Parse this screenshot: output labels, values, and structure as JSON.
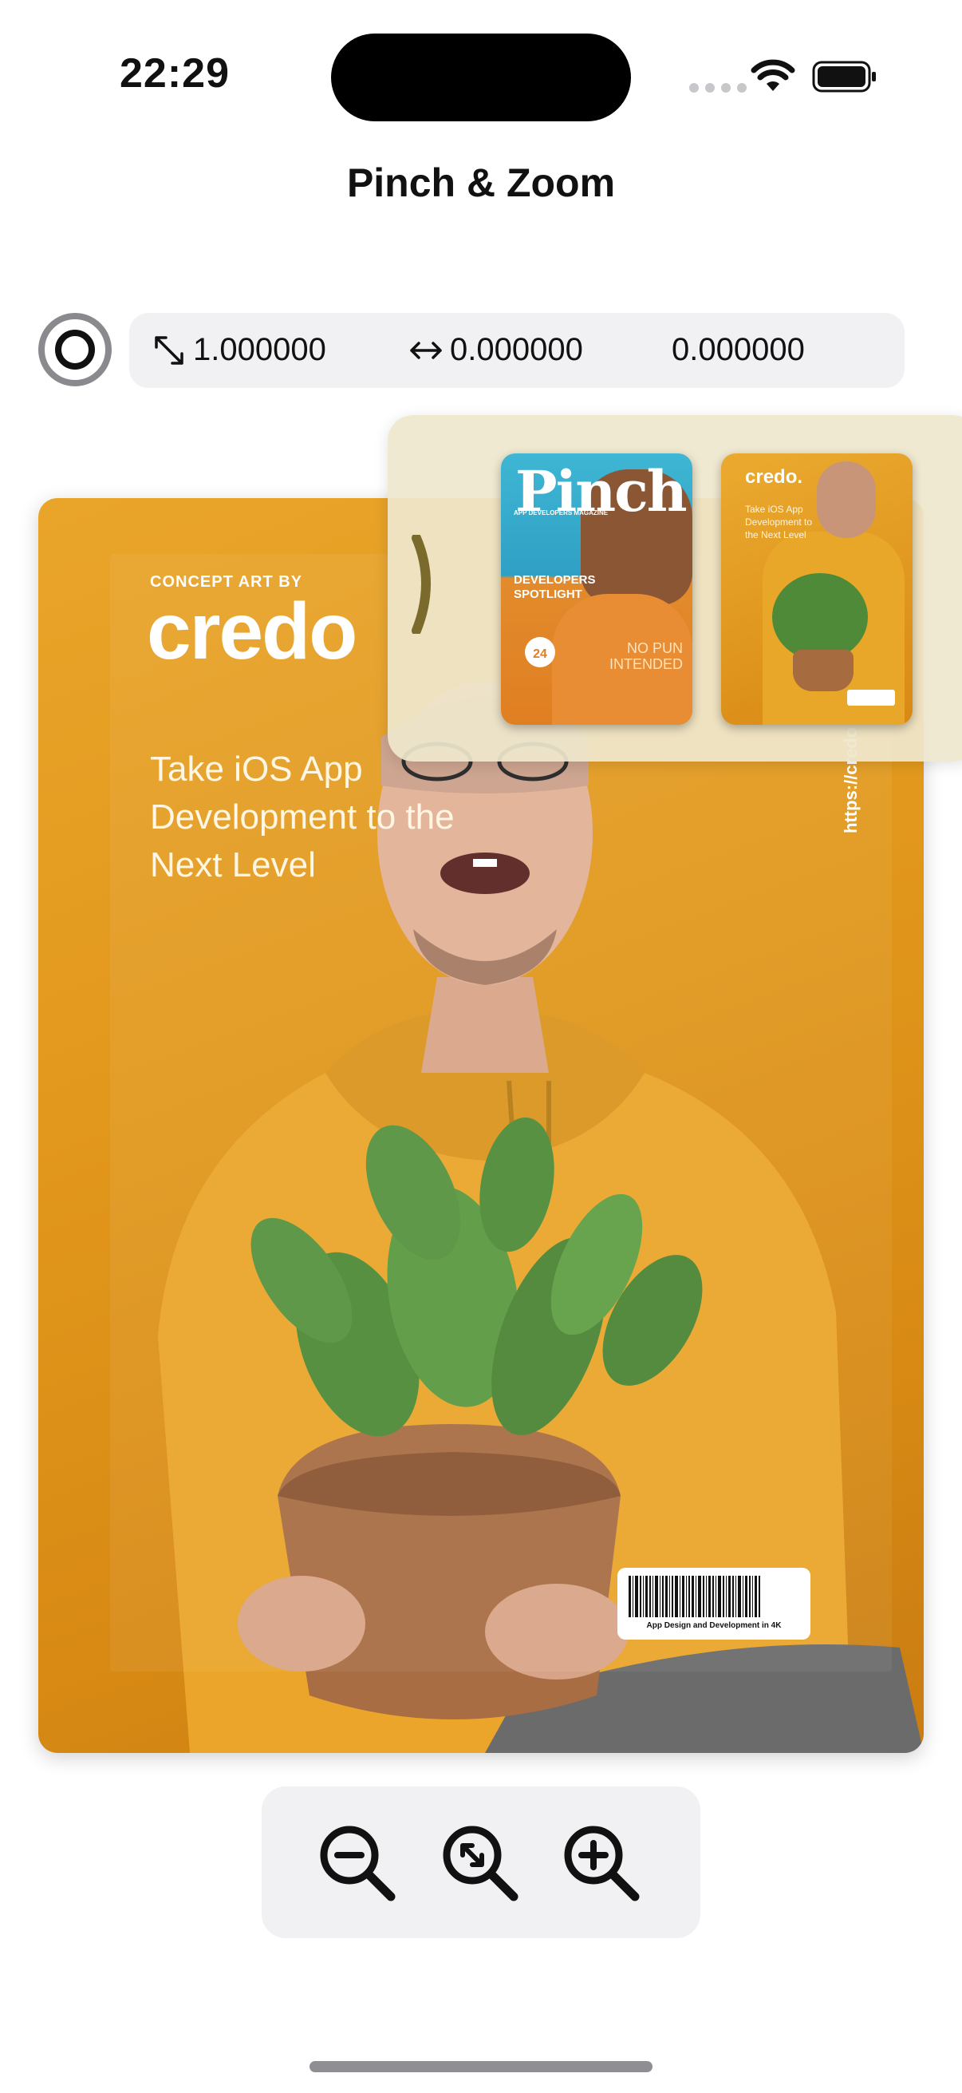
{
  "status_bar": {
    "time": "22:29"
  },
  "nav": {
    "title": "Pinch & Zoom"
  },
  "info_panel": {
    "scale": "1.000000",
    "offset_x": "0.000000",
    "offset_y": "0.000000"
  },
  "poster": {
    "kicker": "CONCEPT ART BY",
    "brand": "credo",
    "tagline": "Take iOS App Development to the Next Level",
    "url": "https://credo.a",
    "barcode_caption": "App Design and Development in 4K"
  },
  "drawer": {
    "thumbnails": [
      {
        "title": "Pinch",
        "subtitle": "APP DEVELOPERS MAGAZINE",
        "badge": "DEVELOPERS SPOTLIGHT",
        "issue": "24",
        "tagline": "NO PUN INTENDED"
      },
      {
        "brand": "credo.",
        "tagline": "Take iOS App Development to the Next Level"
      }
    ]
  },
  "toolbar": {
    "zoom_out_icon": "zoom-out-icon",
    "zoom_reset_icon": "zoom-reset-icon",
    "zoom_in_icon": "zoom-in-icon"
  },
  "colors": {
    "accent": "#e2981c",
    "drawer_bg": "#efe7cd",
    "toolbar_bg": "#f1f1f3"
  }
}
